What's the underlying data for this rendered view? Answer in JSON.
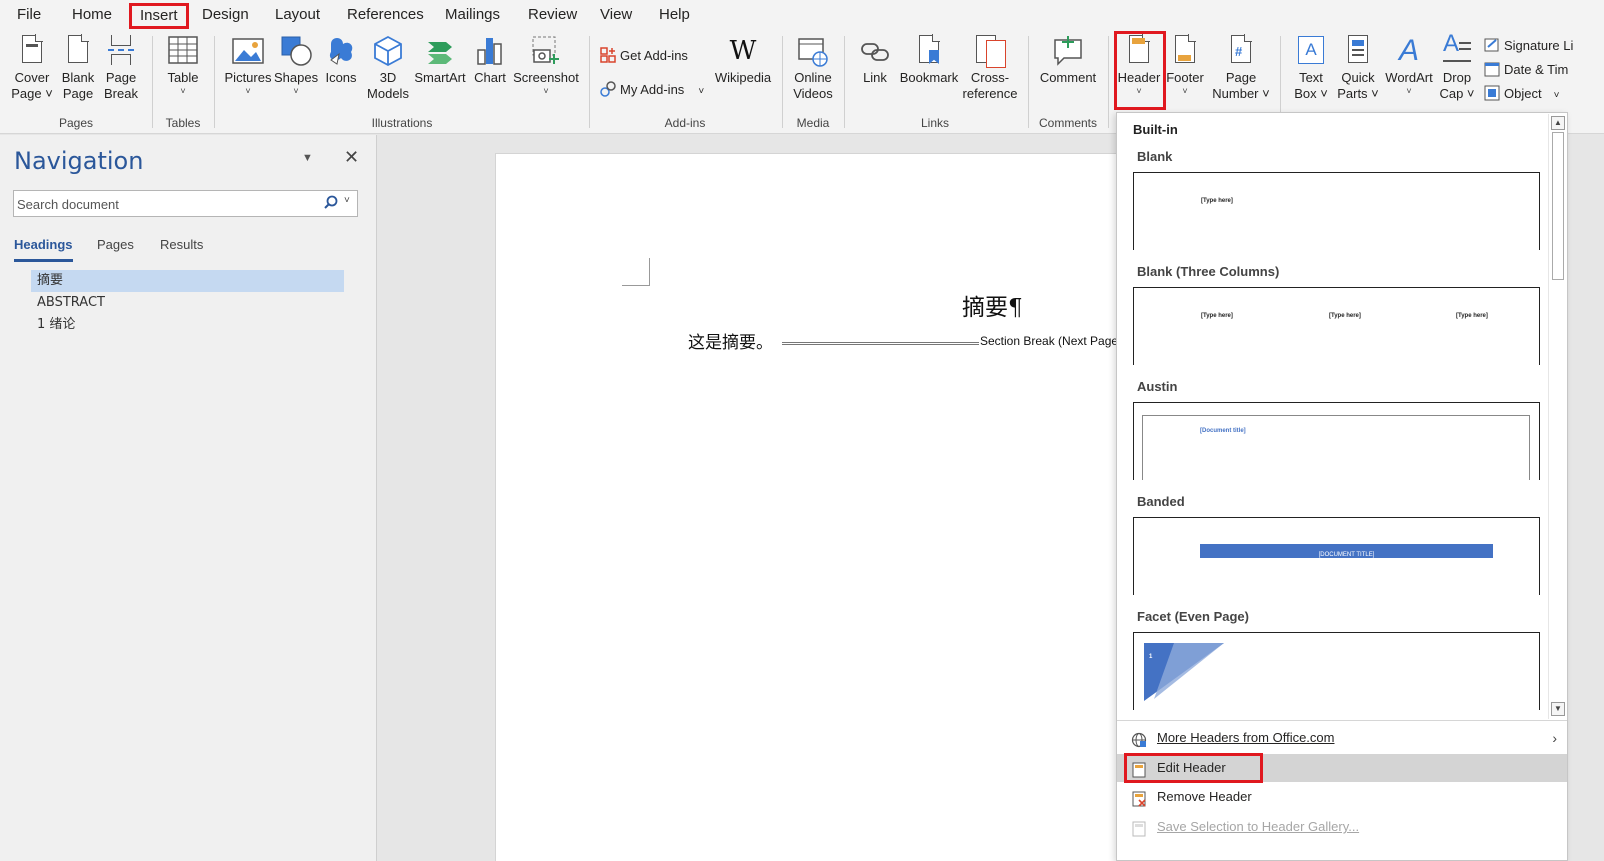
{
  "menu": {
    "tabs": [
      "File",
      "Home",
      "Insert",
      "Design",
      "Layout",
      "References",
      "Mailings",
      "Review",
      "View",
      "Help"
    ],
    "active": "Insert"
  },
  "ribbon": {
    "pages": {
      "cover_page": "Cover",
      "cover_page2": "Page",
      "blank_page": "Blank",
      "blank_page2": "Page",
      "page_break": "Page",
      "page_break2": "Break",
      "group": "Pages"
    },
    "tables": {
      "table": "Table",
      "group": "Tables"
    },
    "illustrations": {
      "pictures": "Pictures",
      "shapes": "Shapes",
      "icons": "Icons",
      "models": "3D",
      "models2": "Models",
      "smartart": "SmartArt",
      "chart": "Chart",
      "screenshot": "Screenshot",
      "group": "Illustrations"
    },
    "addins": {
      "get": "Get Add-ins",
      "my": "My Add-ins",
      "wikipedia": "Wikipedia",
      "group": "Add-ins"
    },
    "media": {
      "online": "Online",
      "online2": "Videos",
      "group": "Media"
    },
    "links": {
      "link": "Link",
      "bookmark": "Bookmark",
      "crossref": "Cross-",
      "crossref2": "reference",
      "group": "Links"
    },
    "comments": {
      "comment": "Comment",
      "group": "Comments"
    },
    "header_footer": {
      "header": "Header",
      "footer": "Footer",
      "page_number": "Page",
      "page_number2": "Number"
    },
    "text": {
      "textbox": "Text",
      "textbox2": "Box",
      "quickparts": "Quick",
      "quickparts2": "Parts",
      "wordart": "WordArt",
      "dropcap": "Drop",
      "dropcap2": "Cap",
      "signature": "Signature Li",
      "datetime": "Date & Tim",
      "object": "Object"
    }
  },
  "navigation": {
    "title": "Navigation",
    "search_placeholder": "Search document",
    "tabs": [
      "Headings",
      "Pages",
      "Results"
    ],
    "headings": [
      "摘要",
      "ABSTRACT",
      "1 绪论"
    ]
  },
  "document": {
    "heading": "摘要¶",
    "paragraph": "这是摘要。",
    "section_break": "Section Break (Next Page"
  },
  "gallery": {
    "builtin": "Built-in",
    "items": [
      {
        "name": "Blank",
        "placeholders": [
          "[Type here]"
        ]
      },
      {
        "name": "Blank (Three Columns)",
        "placeholders": [
          "[Type here]",
          "[Type here]",
          "[Type here]"
        ]
      },
      {
        "name": "Austin",
        "placeholders": [
          "[Document title]"
        ]
      },
      {
        "name": "Banded",
        "placeholders": [
          "[DOCUMENT TITLE]"
        ]
      },
      {
        "name": "Facet (Even Page)",
        "placeholders": [
          "1"
        ]
      }
    ],
    "more": "More Headers from Office.com",
    "edit": "Edit Header",
    "remove": "Remove Header",
    "save": "Save Selection to Header Gallery...",
    "colors": {
      "highlight": "#e0181f",
      "accent": "#4472c4"
    }
  }
}
